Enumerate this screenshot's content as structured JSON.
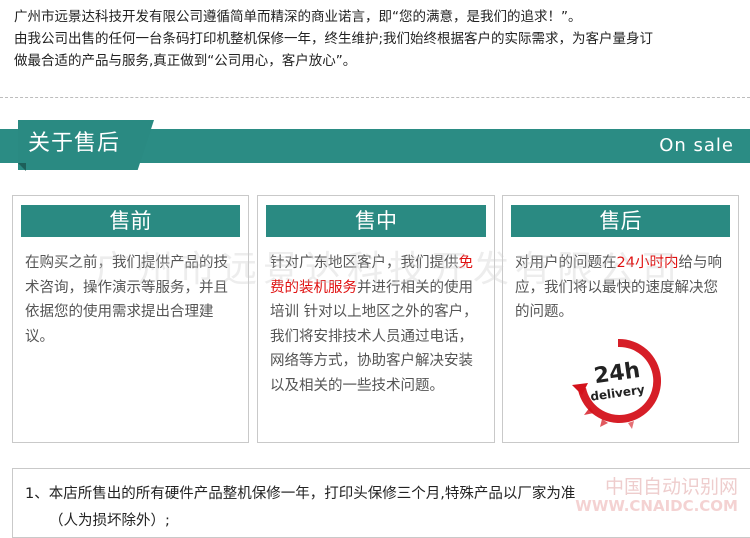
{
  "intro": {
    "line1": "广州市远景达科技开发有限公司遵循简单而精深的商业诺言，即“您的满意，是我们的追求！”。",
    "line2": "由我公司出售的任何一台条码打印机整机保修一年，终生维护;我们始终根据客户的实际需求，为客户量身订",
    "line3": "做最合适的产品与服务,真正做到“公司用心，客户放心”。"
  },
  "section": {
    "title": "关于售后",
    "tag": "On sale"
  },
  "cards": [
    {
      "heading": "售前",
      "text": "在购买之前，我们提供产品的技术咨询，操作演示等服务，并且依据您的使用需求提出合理建议。"
    },
    {
      "heading": "售中",
      "text_before": "针对广东地区客户，我们提供",
      "highlight": "免费的装机服务",
      "text_after": "并进行相关的使用培训 针对以上地区之外的客户，我们将安排技术人员通过电话，网络等方式，协助客户解决安装以及相关的一些技术问题。"
    },
    {
      "heading": "售后",
      "text_before": "对用户的问题在",
      "highlight": "24小时内",
      "text_after": "给与响应，我们将以最快的速度解决您的问题。"
    }
  ],
  "badge": {
    "number": "24h",
    "word": "delivery"
  },
  "watermark": "广州市远景达科技开发有限公司",
  "note": {
    "line1": "1、本店所售出的所有硬件产品整机保修一年，打印头保修三个月,特殊产品以厂家为准",
    "line2": "（人为损坏除外）;"
  },
  "site_logo": {
    "name": "中国自动识别网",
    "url": "WWW.CNAIDC.COM"
  },
  "colors": {
    "teal": "#2a8a82",
    "highlight_red": "#e01010"
  }
}
